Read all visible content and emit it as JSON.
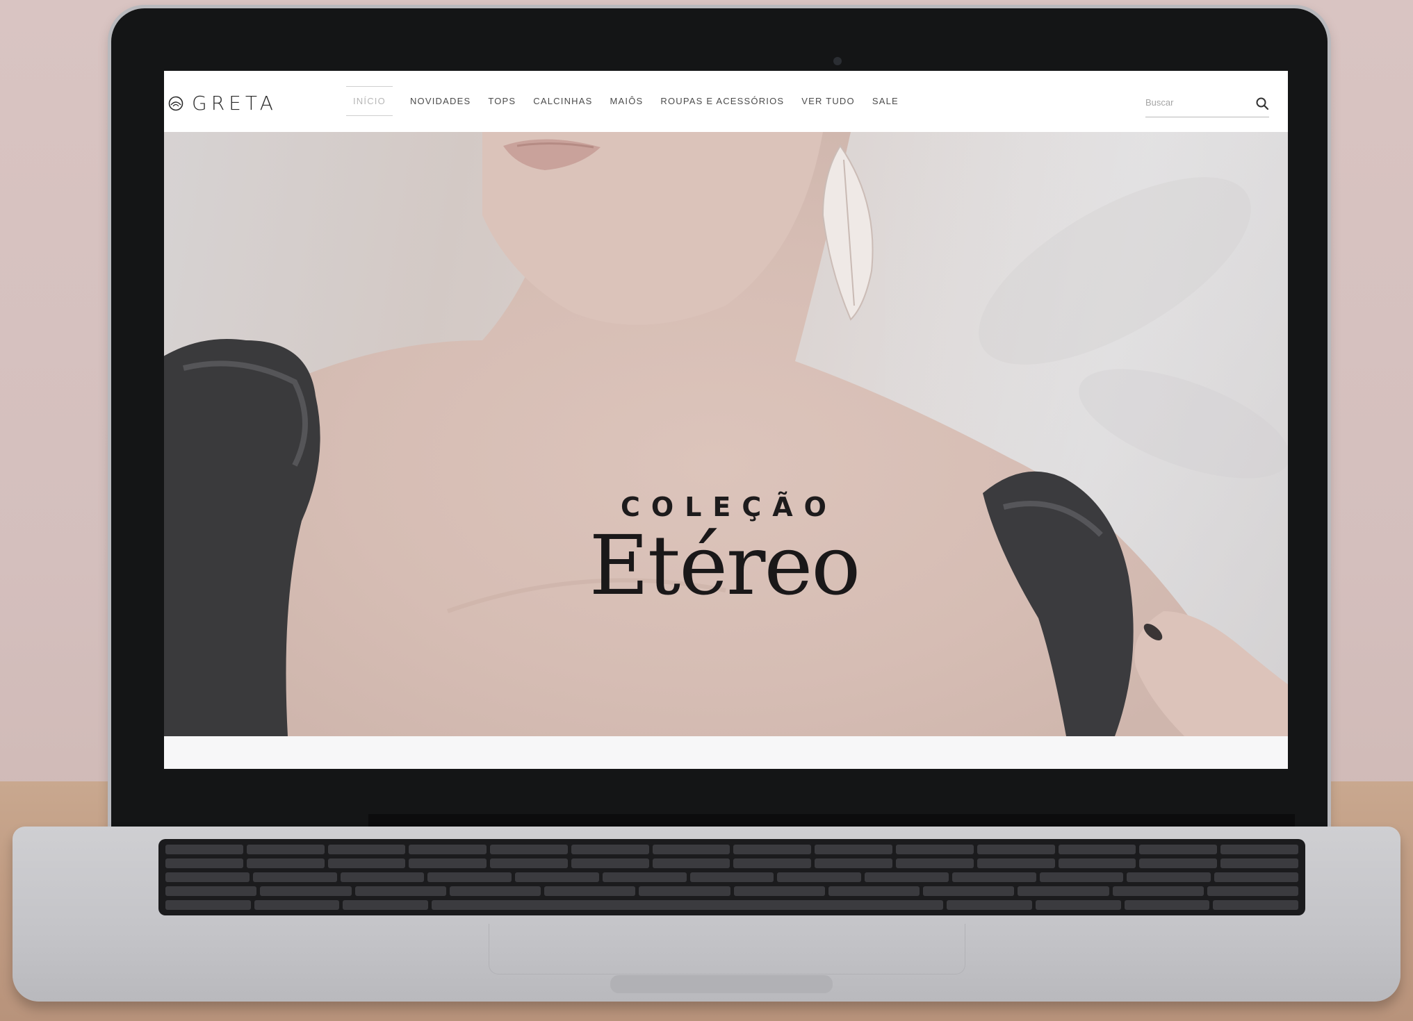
{
  "brand": {
    "name": "GRETA",
    "icon": "circle-leaf-logo-icon"
  },
  "nav": {
    "items": [
      {
        "label": "INÍCIO",
        "active": true
      },
      {
        "label": "NOVIDADES",
        "active": false
      },
      {
        "label": "TOPS",
        "active": false
      },
      {
        "label": "CALCINHAS",
        "active": false
      },
      {
        "label": "MAIÔS",
        "active": false
      },
      {
        "label": "ROUPAS E ACESSÓRIOS",
        "active": false
      },
      {
        "label": "VER TUDO",
        "active": false
      },
      {
        "label": "SALE",
        "active": false
      }
    ]
  },
  "search": {
    "placeholder": "Buscar",
    "icon": "search-icon"
  },
  "hero": {
    "kicker": "COLEÇÃO",
    "title": "Etéreo"
  },
  "colors": {
    "nav_text": "#4b4b4b",
    "nav_active": "#b7b7b7",
    "hero_text": "#1a1819",
    "page_background": "#f7f7f8"
  }
}
